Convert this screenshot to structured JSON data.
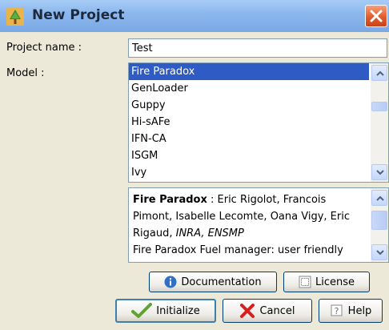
{
  "window": {
    "title": "New Project",
    "close_icon": "close-icon"
  },
  "form": {
    "project_name_label": "Project name :",
    "project_name_value": "Test",
    "model_label": "Model :"
  },
  "models": {
    "items": [
      "Fire Paradox",
      "GenLoader",
      "Guppy",
      "Hi-sAFe",
      "IFN-CA",
      "ISGM",
      "Ivy"
    ],
    "selected": "Fire Paradox"
  },
  "description": {
    "title": "Fire Paradox",
    "authors_prefix": " : Eric Rigolot, Francois Pimont, Isabelle Lecomte, Oana Vigy, Eric Rigaud, ",
    "institutions": "INRA, ENSMP",
    "extra": "Fire Paradox Fuel manager: user friendly"
  },
  "buttons": {
    "documentation": "Documentation",
    "license": "License",
    "initialize": "Initialize",
    "cancel": "Cancel",
    "help": "Help"
  },
  "colors": {
    "selection": "#2F5BC5",
    "titlebar": "#8CB8EE",
    "close": "#E35B2C"
  }
}
